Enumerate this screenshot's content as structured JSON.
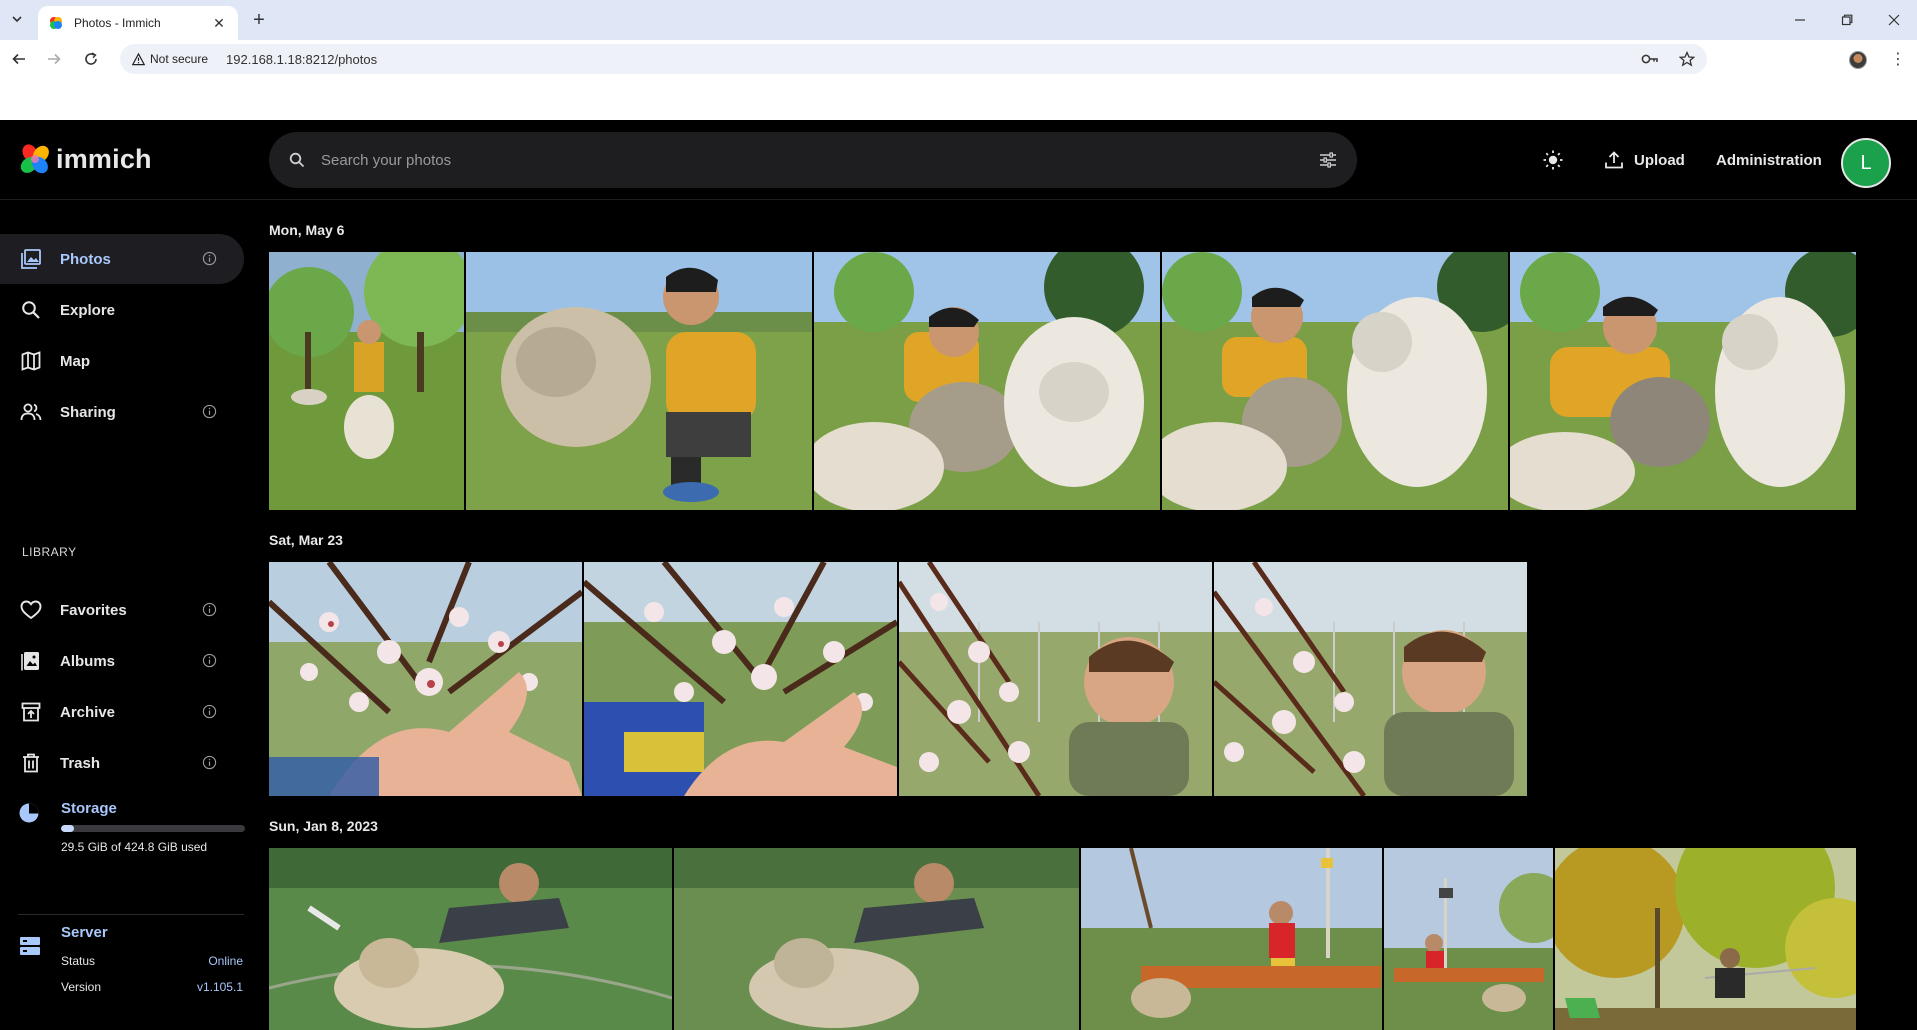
{
  "browser": {
    "tab_title": "Photos - Immich",
    "security_label": "Not secure",
    "url": "192.168.1.18:8212/photos"
  },
  "header": {
    "logo_text": "immich",
    "search_placeholder": "Search your photos",
    "upload_label": "Upload",
    "admin_label": "Administration",
    "avatar_initial": "L"
  },
  "sidebar": {
    "items": [
      {
        "label": "Photos",
        "icon": "photos-icon"
      },
      {
        "label": "Explore",
        "icon": "search-icon"
      },
      {
        "label": "Map",
        "icon": "map-icon"
      },
      {
        "label": "Sharing",
        "icon": "people-icon"
      }
    ],
    "library_title": "LIBRARY",
    "library_items": [
      {
        "label": "Favorites",
        "icon": "heart-icon"
      },
      {
        "label": "Albums",
        "icon": "albums-icon"
      },
      {
        "label": "Archive",
        "icon": "archive-icon"
      },
      {
        "label": "Trash",
        "icon": "trash-icon"
      }
    ],
    "storage": {
      "title": "Storage",
      "used_text": "29.5 GiB of 424.8 GiB used",
      "used_fraction": 0.069
    },
    "server": {
      "title": "Server",
      "status_label": "Status",
      "status_value": "Online",
      "version_label": "Version",
      "version_value": "v1.105.1"
    }
  },
  "timeline": {
    "groups": [
      {
        "date": "Mon, May 6"
      },
      {
        "date": "Sat, Mar 23"
      },
      {
        "date": "Sun, Jan 8, 2023"
      }
    ]
  },
  "colors": {
    "accent": "#a8c7fa",
    "avatar": "#1ba04b",
    "background": "#000000"
  }
}
